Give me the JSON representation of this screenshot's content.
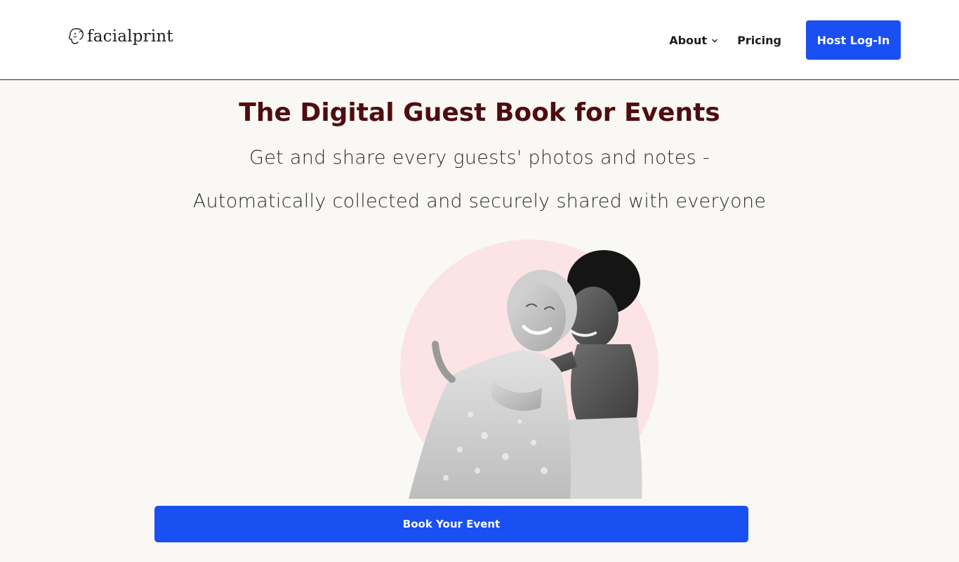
{
  "brand": {
    "name": "facialprint",
    "logo_icon": "face-sketch-icon"
  },
  "nav": {
    "about_label": "About",
    "pricing_label": "Pricing",
    "login_label": "Host Log-In"
  },
  "hero": {
    "headline": "The Digital Guest Book for Events",
    "subline_1": "Get and share every guests' photos and notes -",
    "subline_2": "Automatically collected and securely shared with everyone",
    "cta_label": "Book Your Event"
  },
  "colors": {
    "accent": "#1a4ff2",
    "headline": "#4f0d10",
    "background": "#f9f8f4",
    "circle": "#fbe3e6"
  }
}
